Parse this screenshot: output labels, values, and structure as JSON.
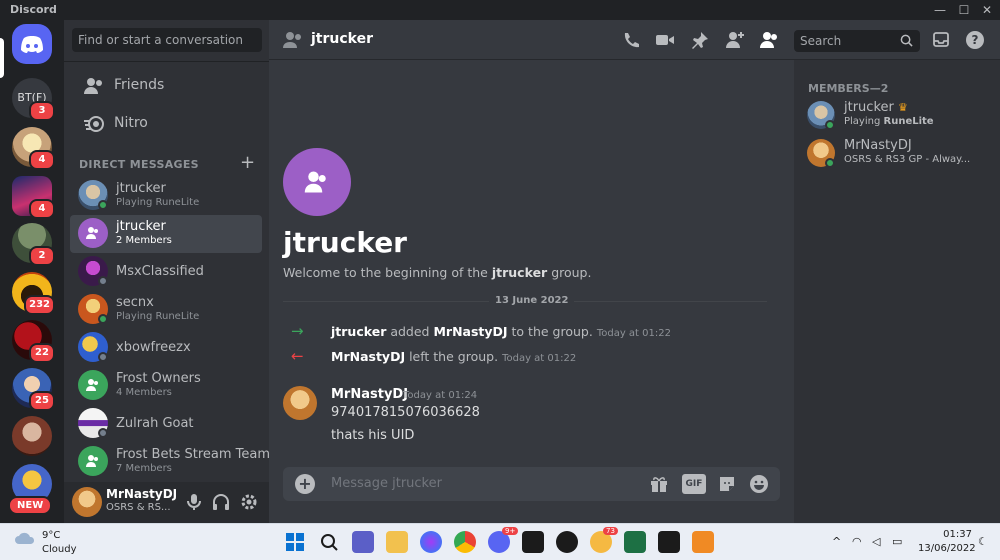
{
  "app": {
    "title": "Discord"
  },
  "window_controls": {
    "minimize": "—",
    "maximize": "☐",
    "close": "✕"
  },
  "servers": [
    {
      "label": "BT(F)",
      "badge": "3"
    },
    {
      "label": "",
      "badge": "4"
    },
    {
      "label": "",
      "badge": "4"
    },
    {
      "label": "",
      "badge": "2"
    },
    {
      "label": "",
      "badge": "232"
    },
    {
      "label": "",
      "badge": "22"
    },
    {
      "label": "",
      "badge": "25"
    },
    {
      "label": "",
      "badge": ""
    },
    {
      "label": "",
      "badge": "NEW"
    }
  ],
  "dm_search": {
    "placeholder": "Find or start a conversation"
  },
  "nav": {
    "friends": "Friends",
    "nitro": "Nitro"
  },
  "dm_header": "DIRECT MESSAGES",
  "dms": [
    {
      "name": "jtrucker",
      "sub": "Playing RuneLite",
      "status": "online"
    },
    {
      "name": "jtrucker",
      "sub": "2 Members",
      "selected": true
    },
    {
      "name": "MsxClassified",
      "sub": "",
      "status": "offline"
    },
    {
      "name": "secnx",
      "sub": "Playing RuneLite",
      "status": "online"
    },
    {
      "name": "xbowfreezx",
      "sub": "",
      "status": "offline"
    },
    {
      "name": "Frost Owners",
      "sub": "4 Members"
    },
    {
      "name": "Zulrah Goat",
      "sub": "",
      "status": "offline"
    },
    {
      "name": "Frost Bets Stream Team",
      "sub": "7 Members"
    }
  ],
  "user_panel": {
    "name": "MrNastyDJ",
    "status": "OSRS & RS..."
  },
  "channel": {
    "name": "jtrucker"
  },
  "header_search": {
    "placeholder": "Search"
  },
  "welcome": {
    "title": "jtrucker",
    "sub_prefix": "Welcome to the beginning of the ",
    "sub_group": "jtrucker",
    "sub_suffix": " group."
  },
  "day_divider": "13 June 2022",
  "system_messages": [
    {
      "actor": "jtrucker",
      "action": " added ",
      "target": "MrNastyDJ",
      "tail": " to the group.",
      "time": "Today at 01:22",
      "kind": "join"
    },
    {
      "actor": "MrNastyDJ",
      "action": " left the group.",
      "target": "",
      "tail": "",
      "time": "Today at 01:22",
      "kind": "leave"
    }
  ],
  "message": {
    "author": "MrNastyDJ",
    "time": "Today at 01:24",
    "lines": [
      "974017815076036628",
      "thats his UID"
    ]
  },
  "composer": {
    "placeholder": "Message jtrucker",
    "gif": "GIF"
  },
  "members": {
    "header": "MEMBERS—2",
    "list": [
      {
        "name": "jtrucker",
        "sub_prefix": "Playing ",
        "sub_bold": "RuneLite"
      },
      {
        "name": "MrNastyDJ",
        "sub_prefix": "OSRS & RS3 GP - Alway...",
        "sub_bold": ""
      }
    ]
  },
  "taskbar": {
    "weather_temp": "9°C",
    "weather_cond": "Cloudy",
    "time": "01:37",
    "date": "13/06/2022",
    "badges": {
      "messenger_plus": "9+",
      "chrome_badge": "73"
    }
  },
  "colors": {
    "accent": "#5865f2",
    "online": "#3ba55c",
    "group_purple": "#9c5fc6",
    "group_green": "#3ba55c",
    "danger": "#ed4245"
  }
}
